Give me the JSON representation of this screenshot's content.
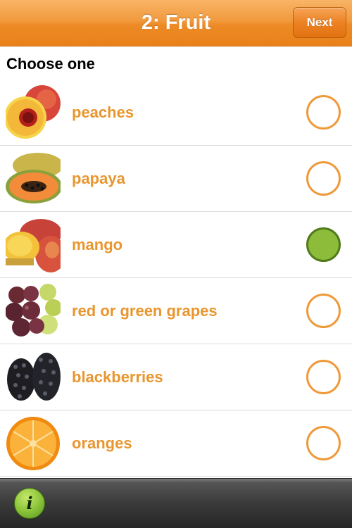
{
  "navbar": {
    "title": "2: Fruit",
    "next_label": "Next"
  },
  "section": {
    "header": "Choose one"
  },
  "options": [
    {
      "label": "peaches",
      "icon": "peach-image",
      "selected": false
    },
    {
      "label": "papaya",
      "icon": "papaya-image",
      "selected": false
    },
    {
      "label": "mango",
      "icon": "mango-image",
      "selected": true
    },
    {
      "label": "red or green grapes",
      "icon": "grapes-image",
      "selected": false
    },
    {
      "label": "blackberries",
      "icon": "blackberry-image",
      "selected": false
    },
    {
      "label": "oranges",
      "icon": "orange-image",
      "selected": false
    }
  ],
  "bottombar": {
    "info_icon": "info-icon",
    "info_glyph": "i"
  },
  "colors": {
    "accent": "#ed8a26",
    "label": "#e8962f",
    "selected": "#8dbb3a"
  }
}
